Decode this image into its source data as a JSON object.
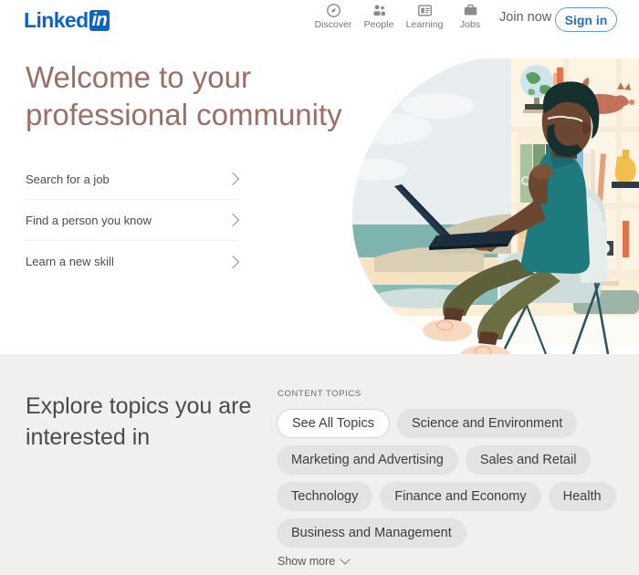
{
  "header": {
    "logo": {
      "text": "Linked",
      "badge": "in"
    },
    "nav_items": [
      {
        "label": "Discover",
        "icon": "compass-icon"
      },
      {
        "label": "People",
        "icon": "people-icon"
      },
      {
        "label": "Learning",
        "icon": "learning-icon"
      },
      {
        "label": "Jobs",
        "icon": "briefcase-icon"
      }
    ],
    "join_now": "Join now",
    "sign_in": "Sign in"
  },
  "hero": {
    "title": "Welcome to your professional community",
    "links": [
      {
        "label": "Search for a job"
      },
      {
        "label": "Find a person you know"
      },
      {
        "label": "Learn a new skill"
      }
    ],
    "illustration_alt": "person-with-laptop-illustration"
  },
  "topics": {
    "heading": "Explore topics you are interested in",
    "section_label": "CONTENT TOPICS",
    "pills": [
      {
        "label": "See All Topics",
        "style": "outline"
      },
      {
        "label": "Science and Environment",
        "style": "filled"
      },
      {
        "label": "Marketing and Advertising",
        "style": "filled"
      },
      {
        "label": "Sales and Retail",
        "style": "filled"
      },
      {
        "label": "Technology",
        "style": "filled"
      },
      {
        "label": "Finance and Economy",
        "style": "filled"
      },
      {
        "label": "Health",
        "style": "filled"
      },
      {
        "label": "Business and Management",
        "style": "filled"
      }
    ],
    "show_more": "Show more"
  },
  "colors": {
    "brand_blue": "#0a66c2",
    "hero_text": "#9c6e66",
    "section_bg": "#f1f0ee",
    "pill_bg": "#e4e3e1"
  }
}
